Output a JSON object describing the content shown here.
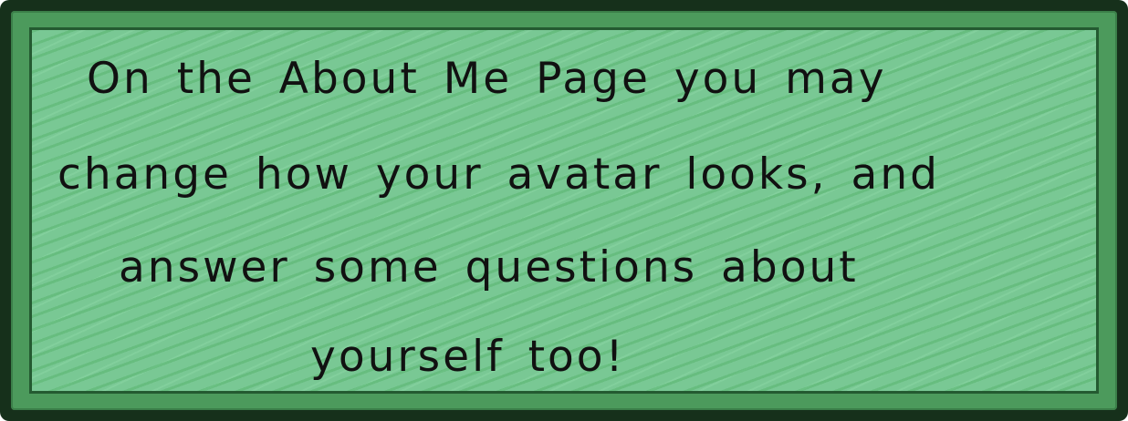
{
  "message": {
    "lines": [
      "On the About Me Page you may",
      "change how your avatar looks, and",
      "answer some questions about",
      "yourself too!"
    ]
  }
}
